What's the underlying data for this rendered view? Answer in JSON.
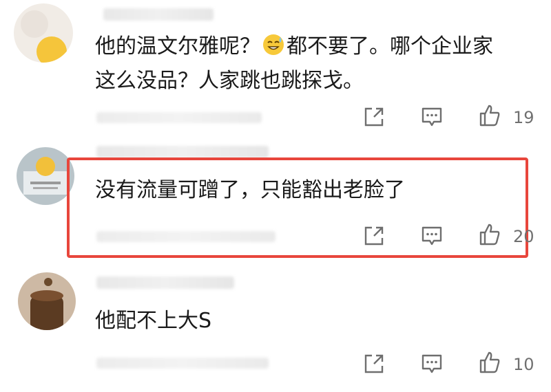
{
  "comments": [
    {
      "line1_pre": "他的温文尔雅呢？",
      "emoji": "sweat-smile-emoji",
      "line1_post": "都不要了。哪个企业家",
      "line2": "这么没品？人家跳也跳探戈。",
      "likes": "19"
    },
    {
      "text": "没有流量可蹭了，只能豁出老脸了",
      "likes": "20",
      "highlighted": true,
      "highlight_color": "#e8463c"
    },
    {
      "text": "他配不上大S",
      "likes": "10"
    }
  ],
  "icons": {
    "share": "share-icon",
    "reply": "comment-icon",
    "like": "thumbs-up-icon"
  }
}
